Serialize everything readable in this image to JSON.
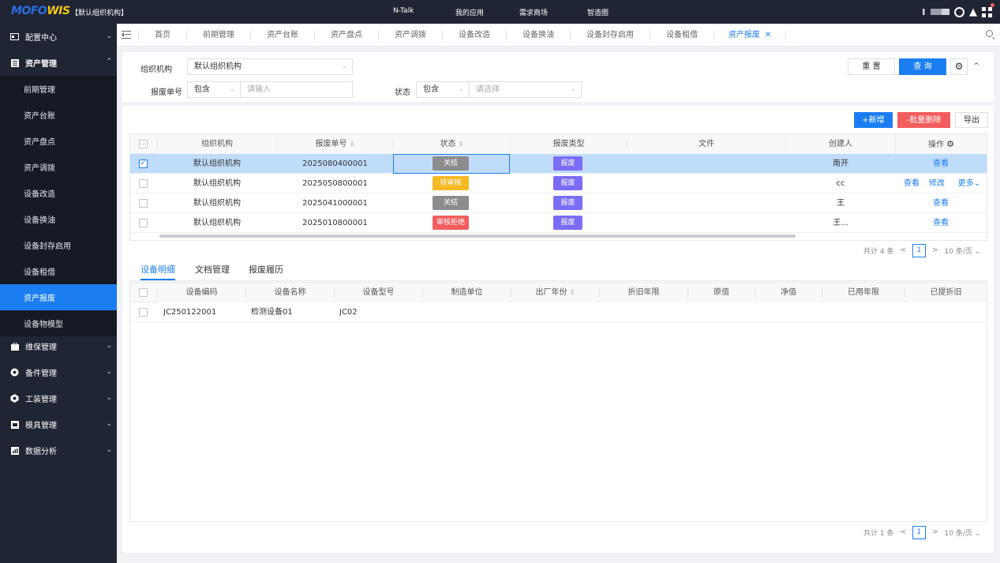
{
  "top": {
    "logo_a": "MOFO",
    "logo_b": "WIS",
    "org": "【默认组织机构】",
    "nav": [
      "N-Talk",
      "我的应用",
      "需求商场",
      "智造圈"
    ]
  },
  "sidebar": {
    "config": "配置中心",
    "asset_mgmt": "资产管理",
    "subs": [
      "前期管理",
      "资产台账",
      "资产盘点",
      "资产调拨",
      "设备改造",
      "设备换油",
      "设备封存启用",
      "设备租借",
      "资产报废",
      "设备物模型"
    ],
    "more": [
      "维保管理",
      "备件管理",
      "工装管理",
      "模具管理",
      "数据分析"
    ]
  },
  "tabs": [
    "首页",
    "前期管理",
    "资产台账",
    "资产盘点",
    "资产调拨",
    "设备改造",
    "设备换油",
    "设备封存启用",
    "设备租借",
    "资产报废"
  ],
  "filter": {
    "org_label": "组织机构",
    "org_value": "默认组织机构",
    "no_label": "报废单号",
    "no_op": "包含",
    "no_placeholder": "请输入",
    "status_label": "状态",
    "status_op": "包含",
    "status_placeholder": "请选择",
    "reset": "重 置",
    "query": "查 询"
  },
  "actions": {
    "add": "+新增",
    "batch_delete": "-批量删除",
    "export": "导出"
  },
  "table": {
    "headers": [
      "组织机构",
      "报废单号",
      "状态",
      "报废类型",
      "文件",
      "创建人",
      "操作"
    ],
    "rows": [
      {
        "org": "默认组织机构",
        "no": "2025080400001",
        "status": "关结",
        "type": "报废",
        "creator": "南开",
        "ops": [
          "查看"
        ]
      },
      {
        "org": "默认组织机构",
        "no": "2025050800001",
        "status": "待审核",
        "type": "报废",
        "creator": "cc",
        "ops": [
          "查看",
          "修改",
          "更多"
        ]
      },
      {
        "org": "默认组织机构",
        "no": "2025041000001",
        "status": "关结",
        "type": "报废",
        "creator": "王",
        "ops": [
          "查看"
        ]
      },
      {
        "org": "默认组织机构",
        "no": "2025010800001",
        "status": "审核拒绝",
        "type": "报废",
        "creator": "王...",
        "ops": [
          "查看"
        ]
      }
    ],
    "pager": {
      "total": "共计 4 条",
      "page": "1",
      "size": "10 条/页"
    }
  },
  "subtabs": [
    "设备明细",
    "文档管理",
    "报废履历"
  ],
  "detail": {
    "headers": [
      "设备编码",
      "设备名称",
      "设备型号",
      "制造单位",
      "出厂年份",
      "折旧年限",
      "原值",
      "净值",
      "已用年限",
      "已提折旧"
    ],
    "rows": [
      {
        "code": "JC250122001",
        "name": "检测设备01",
        "model": "JC02"
      }
    ],
    "pager": {
      "total": "共计 1 条",
      "page": "1",
      "size": "10 条/页"
    }
  },
  "colors": {
    "accent": "#1b7ef0",
    "closed": "#8c8c8c",
    "pending": "#f7b924",
    "rejected": "#f25d5d",
    "type": "#7b6cf6"
  }
}
